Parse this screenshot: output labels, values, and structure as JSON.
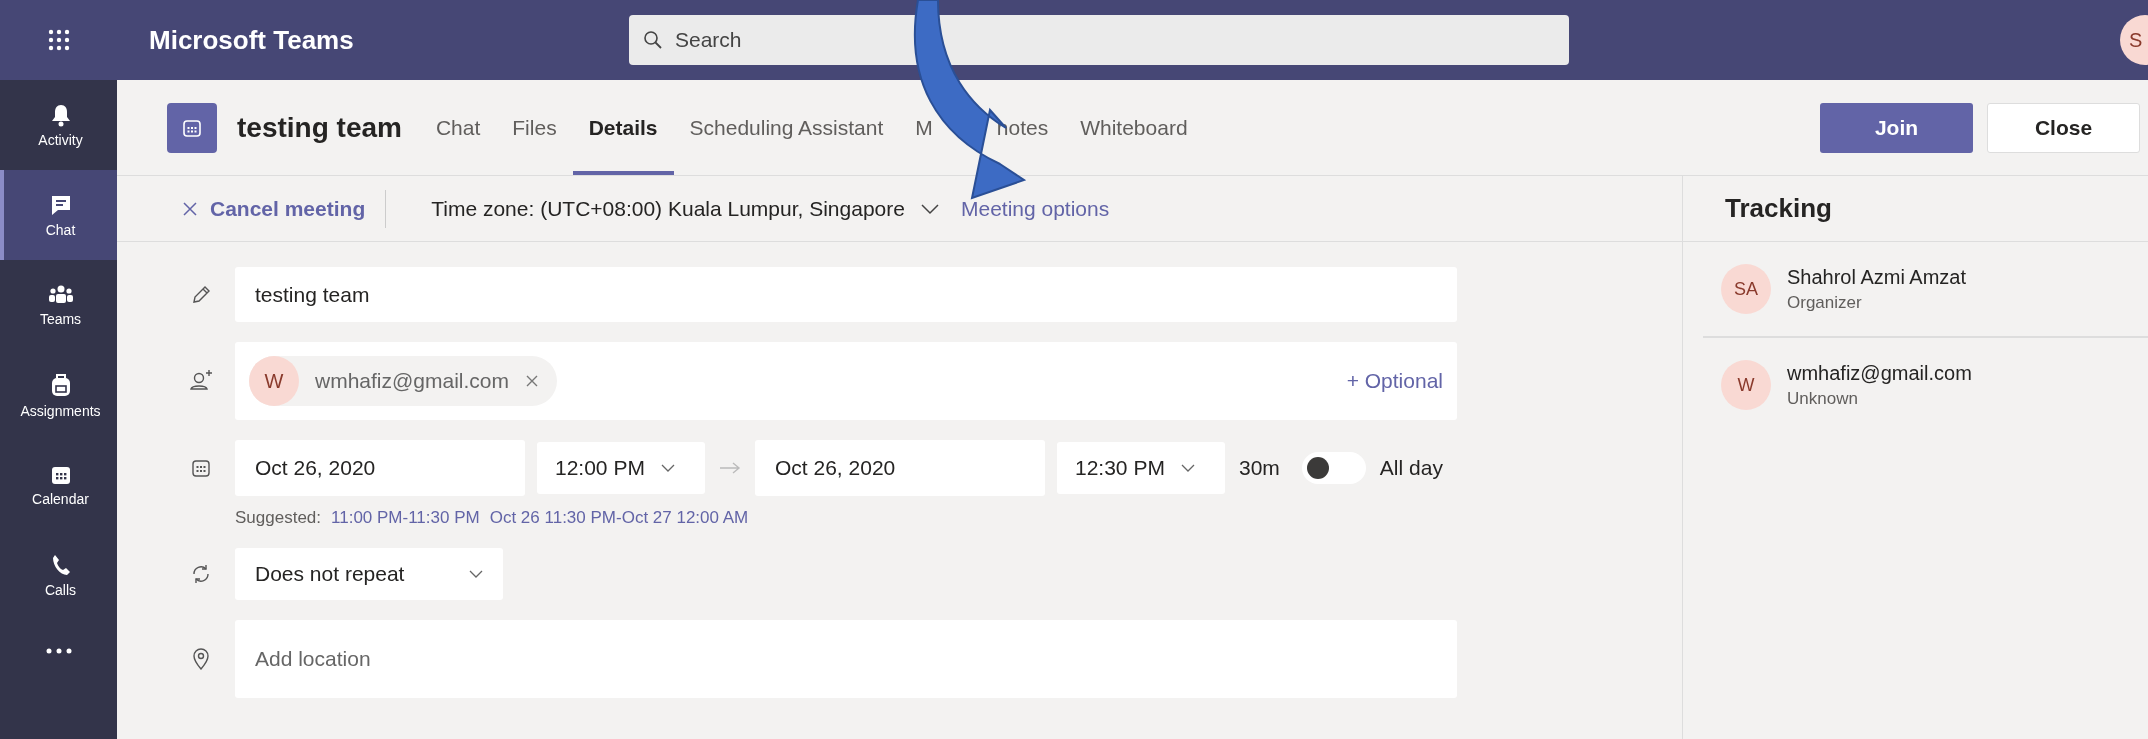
{
  "app": {
    "title": "Microsoft Teams",
    "search": {
      "placeholder": "Search"
    },
    "user_initials": "S"
  },
  "rail": [
    {
      "kind": "bell",
      "label": "Activity",
      "selected": false
    },
    {
      "kind": "chat",
      "label": "Chat",
      "selected": true
    },
    {
      "kind": "teams",
      "label": "Teams",
      "selected": false
    },
    {
      "kind": "bag",
      "label": "Assignments",
      "selected": false
    },
    {
      "kind": "calendar",
      "label": "Calendar",
      "selected": false
    },
    {
      "kind": "phone",
      "label": "Calls",
      "selected": false
    }
  ],
  "meeting": {
    "title": "testing team",
    "tabs": [
      {
        "label": "Chat",
        "selected": false
      },
      {
        "label": "Files",
        "selected": false
      },
      {
        "label": "Details",
        "selected": true
      },
      {
        "label": "Scheduling Assistant",
        "selected": false
      },
      {
        "label_parts": [
          "M",
          "notes"
        ],
        "selected": false
      },
      {
        "label": "Whiteboard",
        "selected": false
      }
    ],
    "buttons": [
      {
        "kind": "primary",
        "label": "Join"
      },
      {
        "kind": "secondary",
        "label": "Close"
      }
    ]
  },
  "toolbar": {
    "cancel": "Cancel meeting",
    "time_zone": "Time zone: (UTC+08:00) Kuala Lumpur, Singapore",
    "options": "Meeting options"
  },
  "form": {
    "title": "testing team",
    "attendees": [
      {
        "initial": "W",
        "email": "wmhafiz@gmail.com"
      }
    ],
    "optional": "+ Optional",
    "start_date": "Oct 26, 2020",
    "start_time": "12:00 PM",
    "end_date": "Oct 26, 2020",
    "end_time": "12:30 PM",
    "duration": "30m",
    "all_day": {
      "label": "All day",
      "on": false
    },
    "suggested_label": "Suggested:",
    "suggestions": [
      "11:00 PM-11:30 PM",
      "Oct 26 11:30 PM-Oct 27 12:00 AM"
    ],
    "repeat": "Does not repeat",
    "location": {
      "placeholder": "Add location"
    }
  },
  "tracking": {
    "title": "Tracking",
    "people": [
      {
        "initials": "SA",
        "name": "Shahrol Azmi Amzat",
        "role": "Organizer"
      },
      {
        "initials": "W",
        "name": "wmhafiz@gmail.com",
        "role": "Unknown"
      }
    ]
  }
}
